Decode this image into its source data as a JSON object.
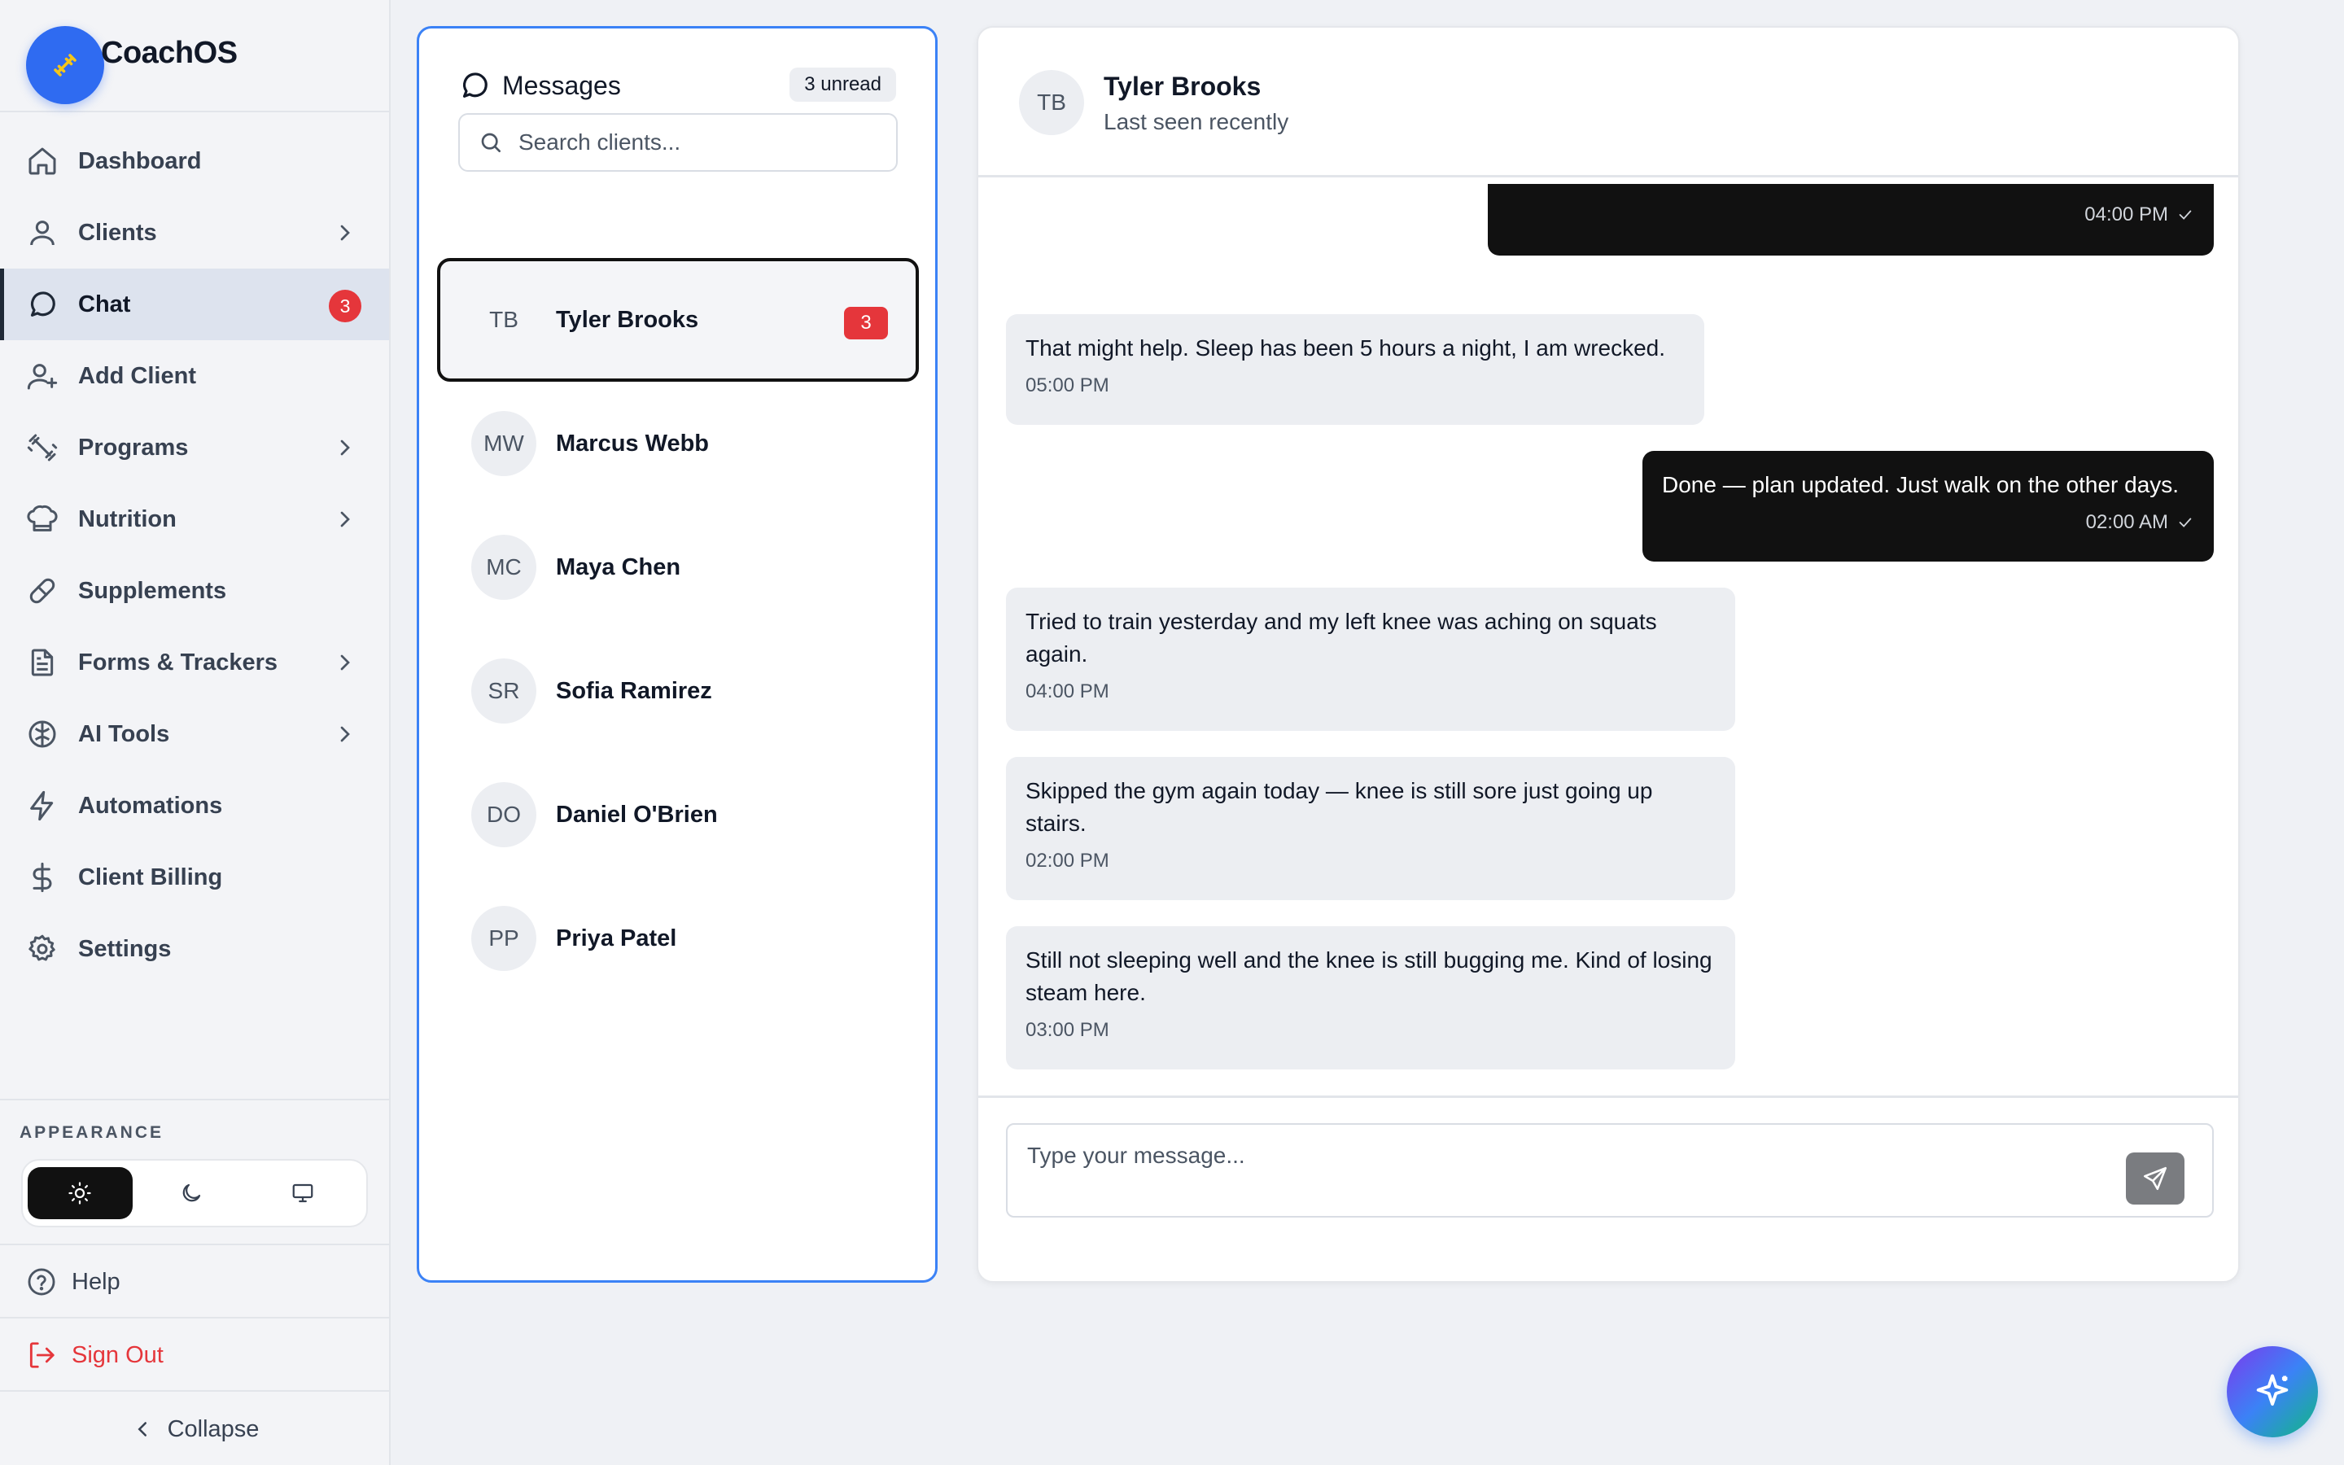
{
  "brand": {
    "name": "CoachOS"
  },
  "nav": {
    "items": [
      {
        "label": "Dashboard",
        "icon": "home-icon"
      },
      {
        "label": "Clients",
        "icon": "user-icon",
        "has_submenu": true
      },
      {
        "label": "Chat",
        "icon": "chat-icon",
        "active": true,
        "badge": "3"
      },
      {
        "label": "Add Client",
        "icon": "user-plus-icon"
      },
      {
        "label": "Programs",
        "icon": "dumbbell-icon",
        "has_submenu": true
      },
      {
        "label": "Nutrition",
        "icon": "chef-hat-icon",
        "has_submenu": true
      },
      {
        "label": "Supplements",
        "icon": "pill-icon"
      },
      {
        "label": "Forms & Trackers",
        "icon": "document-icon",
        "has_submenu": true
      },
      {
        "label": "AI Tools",
        "icon": "brain-icon",
        "has_submenu": true
      },
      {
        "label": "Automations",
        "icon": "bolt-icon"
      },
      {
        "label": "Client Billing",
        "icon": "dollar-icon"
      },
      {
        "label": "Settings",
        "icon": "gear-icon"
      }
    ]
  },
  "appearance": {
    "label": "APPEARANCE",
    "options": [
      "light",
      "dark",
      "system"
    ],
    "selected": "light"
  },
  "footer": {
    "help": "Help",
    "sign_out": "Sign Out",
    "collapse": "Collapse"
  },
  "messages": {
    "title": "Messages",
    "unread": "3 unread",
    "search_placeholder": "Search clients...",
    "clients": [
      {
        "initials": "TB",
        "name": "Tyler Brooks",
        "badge": "3",
        "active": true
      },
      {
        "initials": "MW",
        "name": "Marcus Webb"
      },
      {
        "initials": "MC",
        "name": "Maya Chen"
      },
      {
        "initials": "SR",
        "name": "Sofia Ramirez"
      },
      {
        "initials": "DO",
        "name": "Daniel O'Brien"
      },
      {
        "initials": "PP",
        "name": "Priya Patel"
      }
    ]
  },
  "chat": {
    "initials": "TB",
    "name": "Tyler Brooks",
    "status": "Last seen recently",
    "messages": [
      {
        "direction": "out",
        "text": "",
        "time": "04:00 PM"
      },
      {
        "direction": "in",
        "text": "That might help. Sleep has been 5 hours a night, I am wrecked.",
        "time": "05:00 PM"
      },
      {
        "direction": "out",
        "text": "Done — plan updated. Just walk on the other days.",
        "time": "02:00 AM"
      },
      {
        "direction": "in",
        "text": "Tried to train yesterday and my left knee was aching on squats again.",
        "time": "04:00 PM"
      },
      {
        "direction": "in",
        "text": "Skipped the gym again today — knee is still sore just going up stairs.",
        "time": "02:00 PM"
      },
      {
        "direction": "in",
        "text": "Still not sleeping well and the knee is still bugging me. Kind of losing steam here.",
        "time": "03:00 PM"
      }
    ],
    "composer_placeholder": "Type your message..."
  },
  "colors": {
    "accent": "#2f6bf1",
    "badge": "#e5363b",
    "outgoing_bubble": "#111111",
    "incoming_bubble": "#eceef2",
    "sign_out": "#e5363b"
  }
}
